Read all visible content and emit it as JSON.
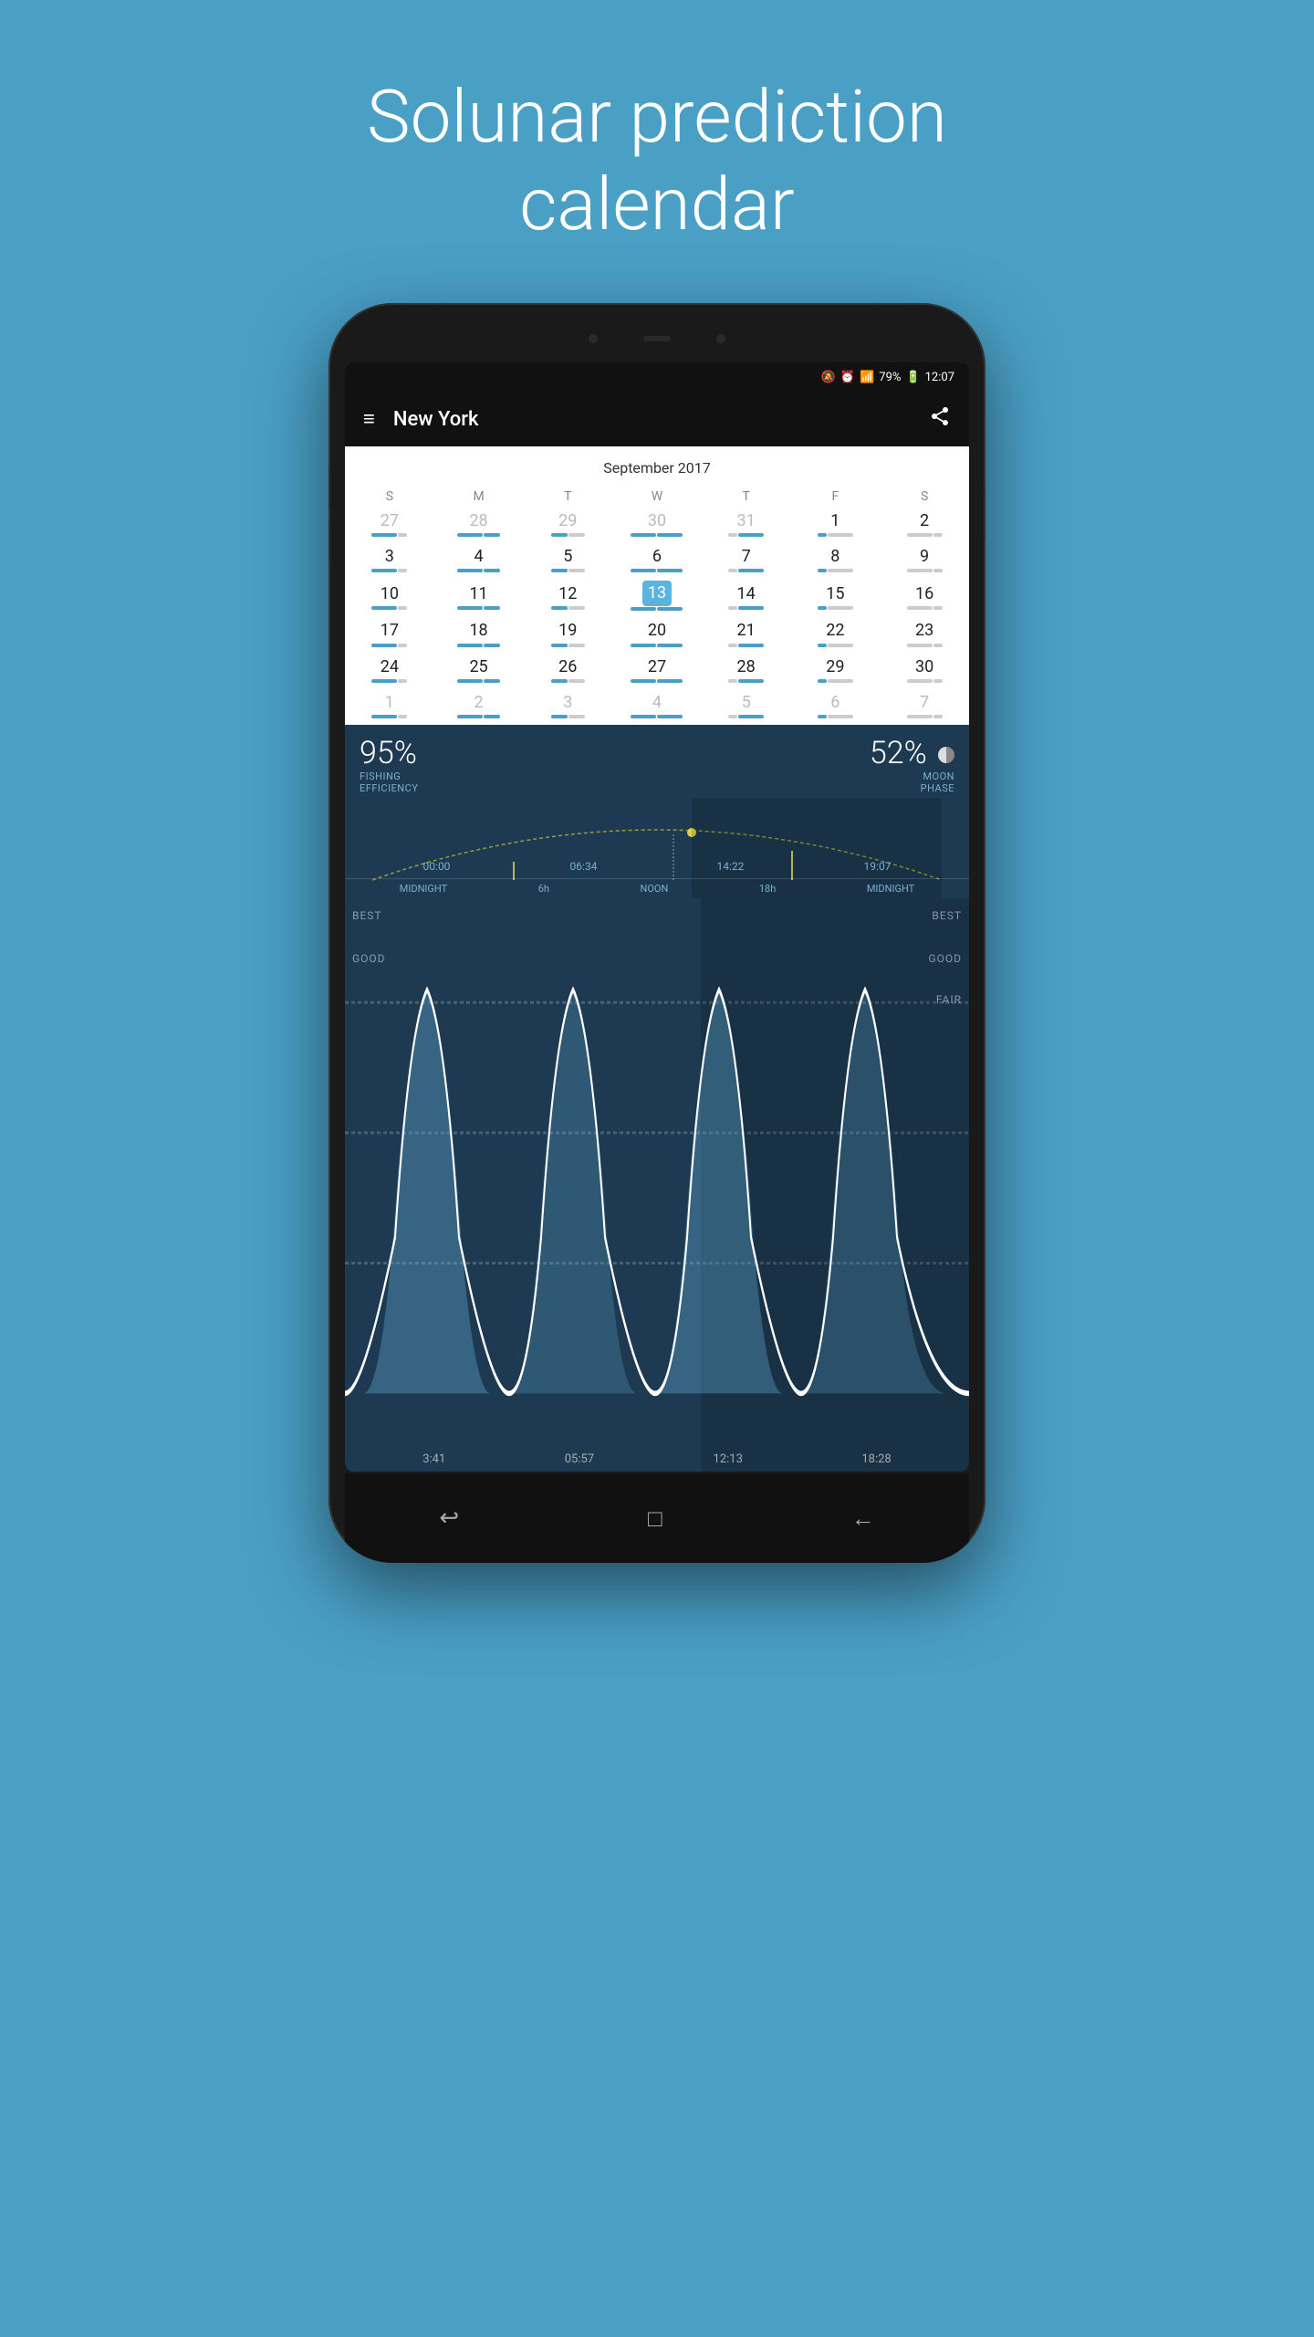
{
  "hero": {
    "title": "Solunar prediction calendar"
  },
  "status_bar": {
    "mute_icon": "🔕",
    "alarm_icon": "⏰",
    "wifi_icon": "WiFi",
    "signal": "4G",
    "battery": "79%",
    "time": "12:07"
  },
  "app_bar": {
    "title": "New York",
    "menu_icon": "≡",
    "share_icon": "share"
  },
  "calendar": {
    "month_year": "September 2017",
    "day_headers": [
      "S",
      "M",
      "T",
      "W",
      "T",
      "F",
      "S"
    ],
    "weeks": [
      [
        {
          "num": "27",
          "type": "prev"
        },
        {
          "num": "28",
          "type": "prev"
        },
        {
          "num": "29",
          "type": "prev"
        },
        {
          "num": "30",
          "type": "prev"
        },
        {
          "num": "31",
          "type": "prev"
        },
        {
          "num": "1",
          "type": "cur"
        },
        {
          "num": "2",
          "type": "cur"
        }
      ],
      [
        {
          "num": "3",
          "type": "cur"
        },
        {
          "num": "4",
          "type": "cur"
        },
        {
          "num": "5",
          "type": "cur"
        },
        {
          "num": "6",
          "type": "cur"
        },
        {
          "num": "7",
          "type": "cur"
        },
        {
          "num": "8",
          "type": "cur"
        },
        {
          "num": "9",
          "type": "cur"
        }
      ],
      [
        {
          "num": "10",
          "type": "cur"
        },
        {
          "num": "11",
          "type": "cur"
        },
        {
          "num": "12",
          "type": "cur"
        },
        {
          "num": "13",
          "type": "selected"
        },
        {
          "num": "14",
          "type": "cur"
        },
        {
          "num": "15",
          "type": "cur"
        },
        {
          "num": "16",
          "type": "cur"
        }
      ],
      [
        {
          "num": "17",
          "type": "cur"
        },
        {
          "num": "18",
          "type": "cur"
        },
        {
          "num": "19",
          "type": "cur"
        },
        {
          "num": "20",
          "type": "cur"
        },
        {
          "num": "21",
          "type": "cur"
        },
        {
          "num": "22",
          "type": "cur"
        },
        {
          "num": "23",
          "type": "cur"
        }
      ],
      [
        {
          "num": "24",
          "type": "cur"
        },
        {
          "num": "25",
          "type": "cur"
        },
        {
          "num": "26",
          "type": "cur"
        },
        {
          "num": "27",
          "type": "cur"
        },
        {
          "num": "28",
          "type": "cur"
        },
        {
          "num": "29",
          "type": "cur"
        },
        {
          "num": "30",
          "type": "cur"
        }
      ],
      [
        {
          "num": "1",
          "type": "next"
        },
        {
          "num": "2",
          "type": "next"
        },
        {
          "num": "3",
          "type": "next"
        },
        {
          "num": "4",
          "type": "next"
        },
        {
          "num": "5",
          "type": "next"
        },
        {
          "num": "6",
          "type": "next"
        },
        {
          "num": "7",
          "type": "next"
        }
      ]
    ]
  },
  "stats": {
    "fishing_efficiency": "95%",
    "fishing_label": "FISHING\nEFFICIENCY",
    "moon_phase": "52%",
    "moon_label": "MOON\nPHASE"
  },
  "sun_chart": {
    "times": [
      "00:00",
      "06:34",
      "14:22",
      "19:07"
    ],
    "axis": [
      "MIDNIGHT",
      "6h",
      "NOON",
      "18h",
      "MIDNIGHT"
    ]
  },
  "wave_chart": {
    "levels_right": [
      "BEST",
      "GOOD",
      "FAIR"
    ],
    "levels_left": [
      "BEST",
      "GOOD"
    ],
    "times": [
      "3:41",
      "05:57",
      "12:13",
      "18:28"
    ]
  },
  "nav": {
    "back": "↩",
    "home": "□",
    "prev": "←"
  }
}
